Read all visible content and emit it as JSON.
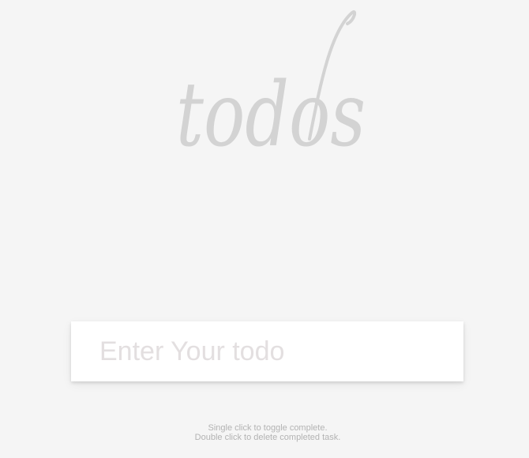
{
  "header": {
    "title": "todos"
  },
  "new_todo": {
    "placeholder": "Enter Your todo",
    "value": ""
  },
  "footer": {
    "line1": "Single click to toggle complete.",
    "line2": "Double click to delete completed task."
  },
  "colors": {
    "background": "#f5f5f5",
    "title": "#d3d3d3",
    "placeholder": "#e3dfe0",
    "footer_text": "#b3b3b3"
  }
}
